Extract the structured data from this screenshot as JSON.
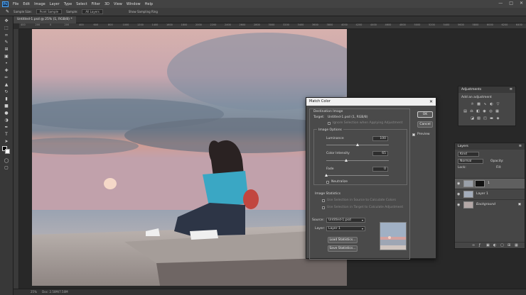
{
  "menubar": {
    "app_logo": "Ps",
    "items": [
      "File",
      "Edit",
      "Image",
      "Layer",
      "Type",
      "Select",
      "Filter",
      "3D",
      "View",
      "Window",
      "Help"
    ]
  },
  "options_bar": {
    "sample_size_label": "Sample Size:",
    "sample_size_value": "Point Sample",
    "sample_label": "Sample:",
    "sample_value": "All Layers",
    "show_ring": "Show Sampling Ring"
  },
  "document": {
    "tab_label": "Untitled-1.psd @ 25% (1, RGB/8) *",
    "status_zoom": "25%",
    "status_info": "Doc: 2.50M/7.50M"
  },
  "ruler_h_ticks": [
    "400",
    "200",
    "0",
    "200",
    "400",
    "600",
    "800",
    "1000",
    "1200",
    "1400",
    "1600",
    "1800",
    "2000",
    "2200",
    "2400",
    "2600",
    "2800",
    "3000",
    "3200",
    "3400",
    "3600",
    "3800",
    "4000",
    "4200",
    "4400",
    "4600",
    "4800",
    "5000",
    "5200",
    "5400",
    "5600",
    "5800",
    "6000",
    "6200",
    "6400"
  ],
  "match_color": {
    "title": "Match Color",
    "destination_image": "Destination Image",
    "target_label": "Target:",
    "target_value": "Untitled-1.psd (1, RGB/8)",
    "ignore_selection": "Ignore Selection when Applying Adjustment",
    "image_options": "Image Options",
    "luminance_label": "Luminance",
    "luminance_value": "100",
    "luminance_level": 0.5,
    "color_intensity_label": "Color Intensity",
    "color_intensity_value": "65",
    "color_intensity_level": 0.32,
    "fade_label": "Fade",
    "fade_value": "0",
    "fade_level": 0.0,
    "neutralize_label": "Neutralize",
    "image_statistics": "Image Statistics",
    "use_sel_source": "Use Selection in Source to Calculate Colors",
    "use_sel_target": "Use Selection in Target to Calculate Adjustment",
    "source_label": "Source:",
    "source_value": "Untitled-1.psd",
    "layer_label": "Layer:",
    "layer_value": "Layer 1",
    "load_stats": "Load Statistics...",
    "save_stats": "Save Statistics...",
    "ok_label": "OK",
    "cancel_label": "Cancel",
    "preview_label": "Preview"
  },
  "adjustments_panel": {
    "title": "Adjustments",
    "subtitle": "Add an adjustment",
    "icons": [
      "brightness-icon",
      "levels-icon",
      "curves-icon",
      "exposure-icon",
      "vibrance-icon",
      "hue-sat-icon",
      "color-balance-icon",
      "bw-icon",
      "photo-filter-icon",
      "channel-mixer-icon",
      "color-lookup-icon",
      "invert-icon",
      "posterize-icon",
      "threshold-icon",
      "gradient-map-icon",
      "selective-color-icon"
    ]
  },
  "layers_panel": {
    "title": "Layers",
    "kind_label": "Kind",
    "blend_mode": "Normal",
    "opacity_label": "Opacity:",
    "lock_label": "Lock:",
    "fill_label": "Fill:",
    "layers": [
      {
        "name": "1",
        "active": true
      },
      {
        "name": "Layer 1",
        "active": false
      },
      {
        "name": "Background",
        "active": false
      }
    ]
  }
}
